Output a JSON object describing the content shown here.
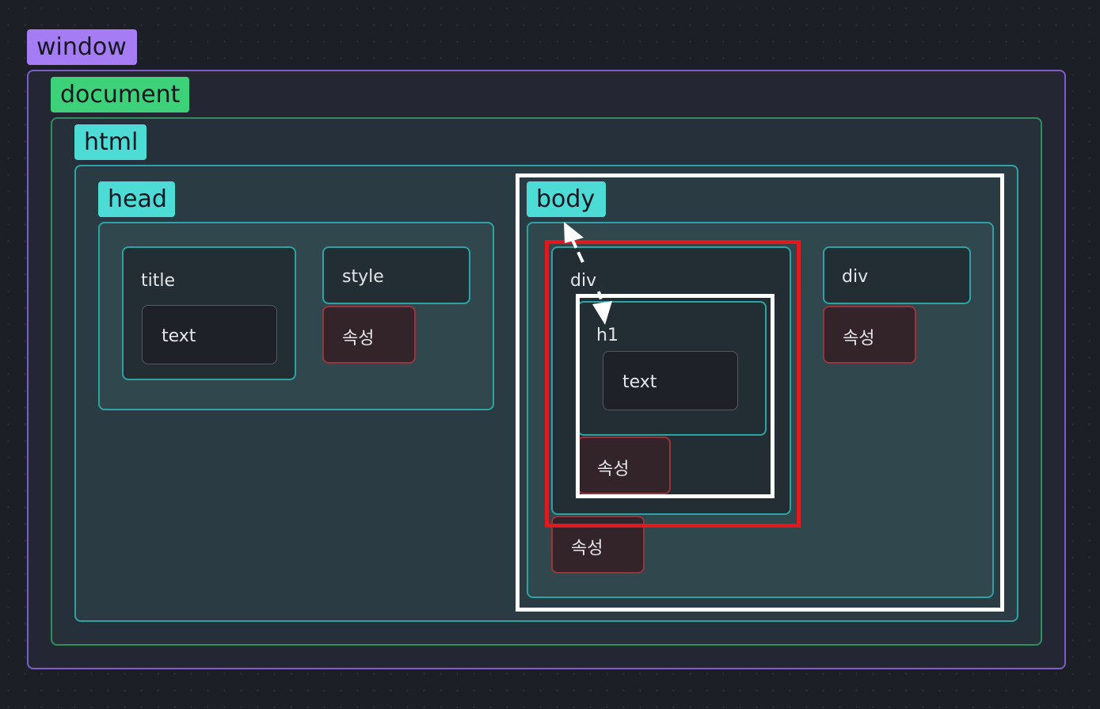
{
  "tags": {
    "window": "window",
    "document": "document",
    "html": "html",
    "head": "head",
    "body": "body"
  },
  "head": {
    "title_label": "title",
    "title_text": "text",
    "style_label": "style",
    "style_attr": "속성"
  },
  "body": {
    "div_label": "div",
    "h1_label": "h1",
    "h1_text": "text",
    "h1_attr": "속성",
    "div_attr": "속성",
    "div2_label": "div",
    "div2_attr": "속성"
  },
  "colors": {
    "window_tag": "#a57cf4",
    "document_tag": "#3dd17a",
    "element_tag": "#4ddbd6",
    "selection_outline": "#ffffff",
    "highlight_outline": "#e0191e"
  },
  "connector_arrows": [
    "body-to-div-arrow",
    "div-to-h1-arrow"
  ]
}
